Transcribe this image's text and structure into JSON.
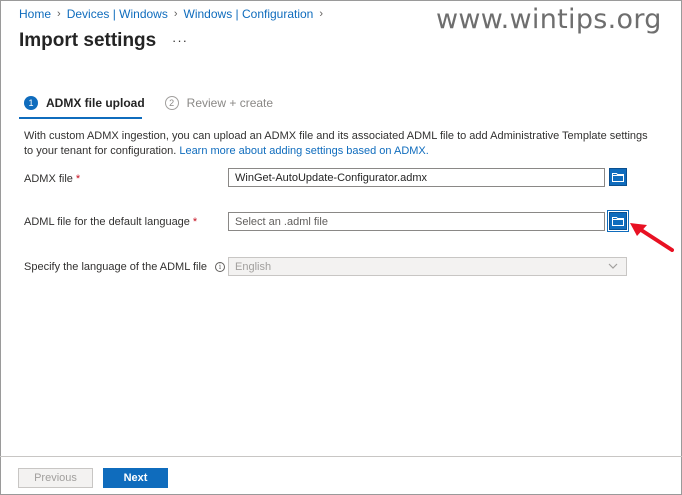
{
  "breadcrumb": {
    "items": [
      "Home",
      "Devices | Windows",
      "Windows | Configuration"
    ]
  },
  "watermark": "www.wintips.org",
  "page": {
    "title": "Import settings",
    "more_label": "···"
  },
  "steps": [
    {
      "number": "1",
      "label": "ADMX file upload",
      "active": true
    },
    {
      "number": "2",
      "label": "Review + create",
      "active": false
    }
  ],
  "description": {
    "text": "With custom ADMX ingestion, you can upload an ADMX file and its associated ADML file to add Administrative Template settings to your tenant for configuration. ",
    "link": "Learn more about adding settings based on ADMX."
  },
  "form": {
    "admx": {
      "label": "ADMX file",
      "required_mark": "*",
      "value": "WinGet-AutoUpdate-Configurator.admx",
      "browse_icon": "folder-icon"
    },
    "adml": {
      "label": "ADML file for the default language",
      "required_mark": "*",
      "placeholder": "Select an .adml file",
      "browse_icon": "folder-icon"
    },
    "language": {
      "label": "Specify the language of the ADML file",
      "info_icon": "i",
      "selected": "English"
    }
  },
  "footer": {
    "previous_label": "Previous",
    "next_label": "Next"
  },
  "colors": {
    "accent": "#0f6cbd",
    "required": "#c50f1f",
    "annotation_arrow": "#e81123"
  }
}
